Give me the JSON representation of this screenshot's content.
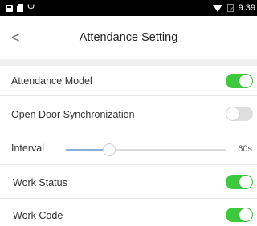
{
  "status_bar": {
    "time": "9:39",
    "left_icons": [
      "image-icon",
      "sd-card-icon",
      "usb-icon"
    ],
    "right_icons": [
      "wifi-icon",
      "sim-icon"
    ]
  },
  "header": {
    "back_glyph": "<",
    "title": "Attendance Setting"
  },
  "settings": {
    "attendance_model": {
      "label": "Attendance Model",
      "enabled": true
    },
    "open_door_sync": {
      "label": "Open Door Synchronization",
      "enabled": false
    },
    "interval": {
      "label": "Interval",
      "value_text": "60s",
      "slider_fraction": 0.27
    },
    "work_status": {
      "label": "Work Status",
      "enabled": true
    },
    "work_code": {
      "label": "Work Code",
      "enabled": true
    }
  },
  "colors": {
    "toggle_on": "#3ec83e",
    "toggle_off": "#dedede",
    "slider_fill": "#8aaedc"
  }
}
